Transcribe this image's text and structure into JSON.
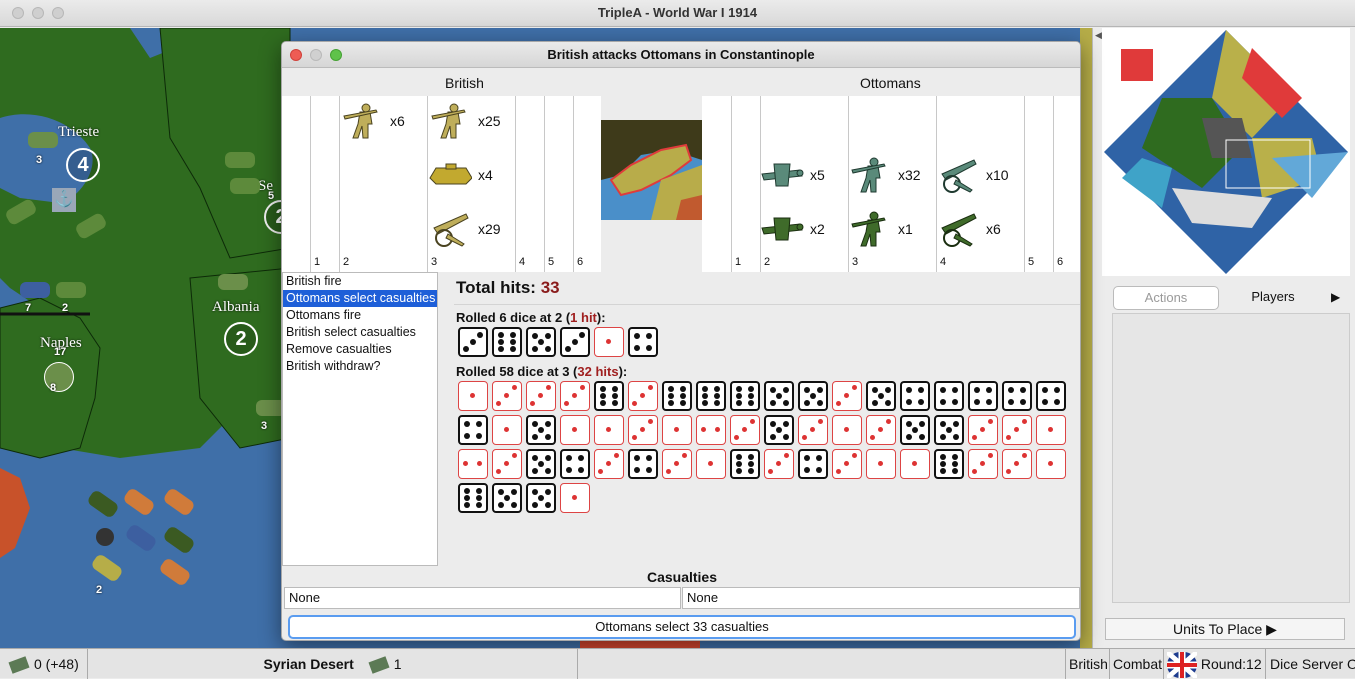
{
  "window": {
    "title": "TripleA - World War I 1914"
  },
  "map": {
    "territories": [
      "Trieste",
      "Albania",
      "Naples",
      "Se"
    ],
    "production": {
      "trieste": "4",
      "albania": "2",
      "se": "2"
    },
    "unit_counts": [
      "3",
      "5",
      "7",
      "2",
      "17",
      "8",
      "3",
      "2"
    ]
  },
  "dialog": {
    "title": "British attacks Ottomans in Constantinople",
    "attacker": "British",
    "defender": "Ottomans",
    "attacker_units": [
      {
        "icon": "infantry-icon",
        "count": "x6"
      },
      {
        "icon": "infantry-icon",
        "count": "x25"
      },
      {
        "icon": "tank-icon",
        "count": "x4"
      },
      {
        "icon": "artillery-icon",
        "count": "x29"
      }
    ],
    "defender_units": [
      {
        "icon": "fighter-icon",
        "count": "x5"
      },
      {
        "icon": "fighter-icon",
        "count": "x2"
      },
      {
        "icon": "infantry-icon",
        "count": "x32"
      },
      {
        "icon": "infantry-icon",
        "count": "x1"
      },
      {
        "icon": "artillery-icon",
        "count": "x10"
      },
      {
        "icon": "artillery-icon",
        "count": "x6"
      }
    ],
    "columns": [
      "1",
      "2",
      "3",
      "4",
      "5",
      "6"
    ],
    "steps": [
      "British fire",
      "Ottomans select casualties",
      "Ottomans fire",
      "British select casualties",
      "Remove casualties",
      "British withdraw?"
    ],
    "selected_step": 1,
    "total_hits_label": "Total hits:",
    "total_hits": "33",
    "roll1": {
      "prefix": "Rolled 6 dice at 2 (",
      "hits": "1 hit",
      "suffix": "):",
      "dice": [
        3,
        6,
        5,
        3,
        1,
        4
      ],
      "threshold": 2
    },
    "roll2": {
      "prefix": "Rolled 58 dice at 3 (",
      "hits": "32 hits",
      "suffix": "):",
      "dice": [
        1,
        3,
        3,
        3,
        6,
        3,
        6,
        6,
        6,
        5,
        5,
        3,
        5,
        4,
        4,
        4,
        4,
        4,
        4,
        1,
        5,
        1,
        1,
        3,
        1,
        2,
        3,
        5,
        3,
        1,
        3,
        5,
        5,
        3,
        3,
        1,
        2,
        3,
        5,
        4,
        3,
        4,
        3,
        1,
        6,
        3,
        4,
        3,
        1,
        1,
        6,
        3,
        3,
        1,
        6,
        5,
        5,
        1
      ],
      "threshold": 3
    },
    "casualties_title": "Casualties",
    "casualties_attacker": "None",
    "casualties_defender": "None",
    "action_button": "Ottomans select 33 casualties"
  },
  "right_panel": {
    "tabs": [
      "Actions",
      "Players"
    ],
    "units_to_place": "Units To Place ▶"
  },
  "status": {
    "pus": "0 (+48)",
    "territory": "Syrian Desert",
    "territory_value": "1",
    "player": "British",
    "phase": "Combat",
    "round": "Round:12",
    "dice_server": "Dice Server O"
  },
  "colors": {
    "british_unit": "#bfae5a",
    "ottoman_unit": "#4d7a5a",
    "hit": "#d33333",
    "selection": "#1e5fd8",
    "land_green": "#2f6b1f",
    "sea": "#3f6fa8"
  }
}
